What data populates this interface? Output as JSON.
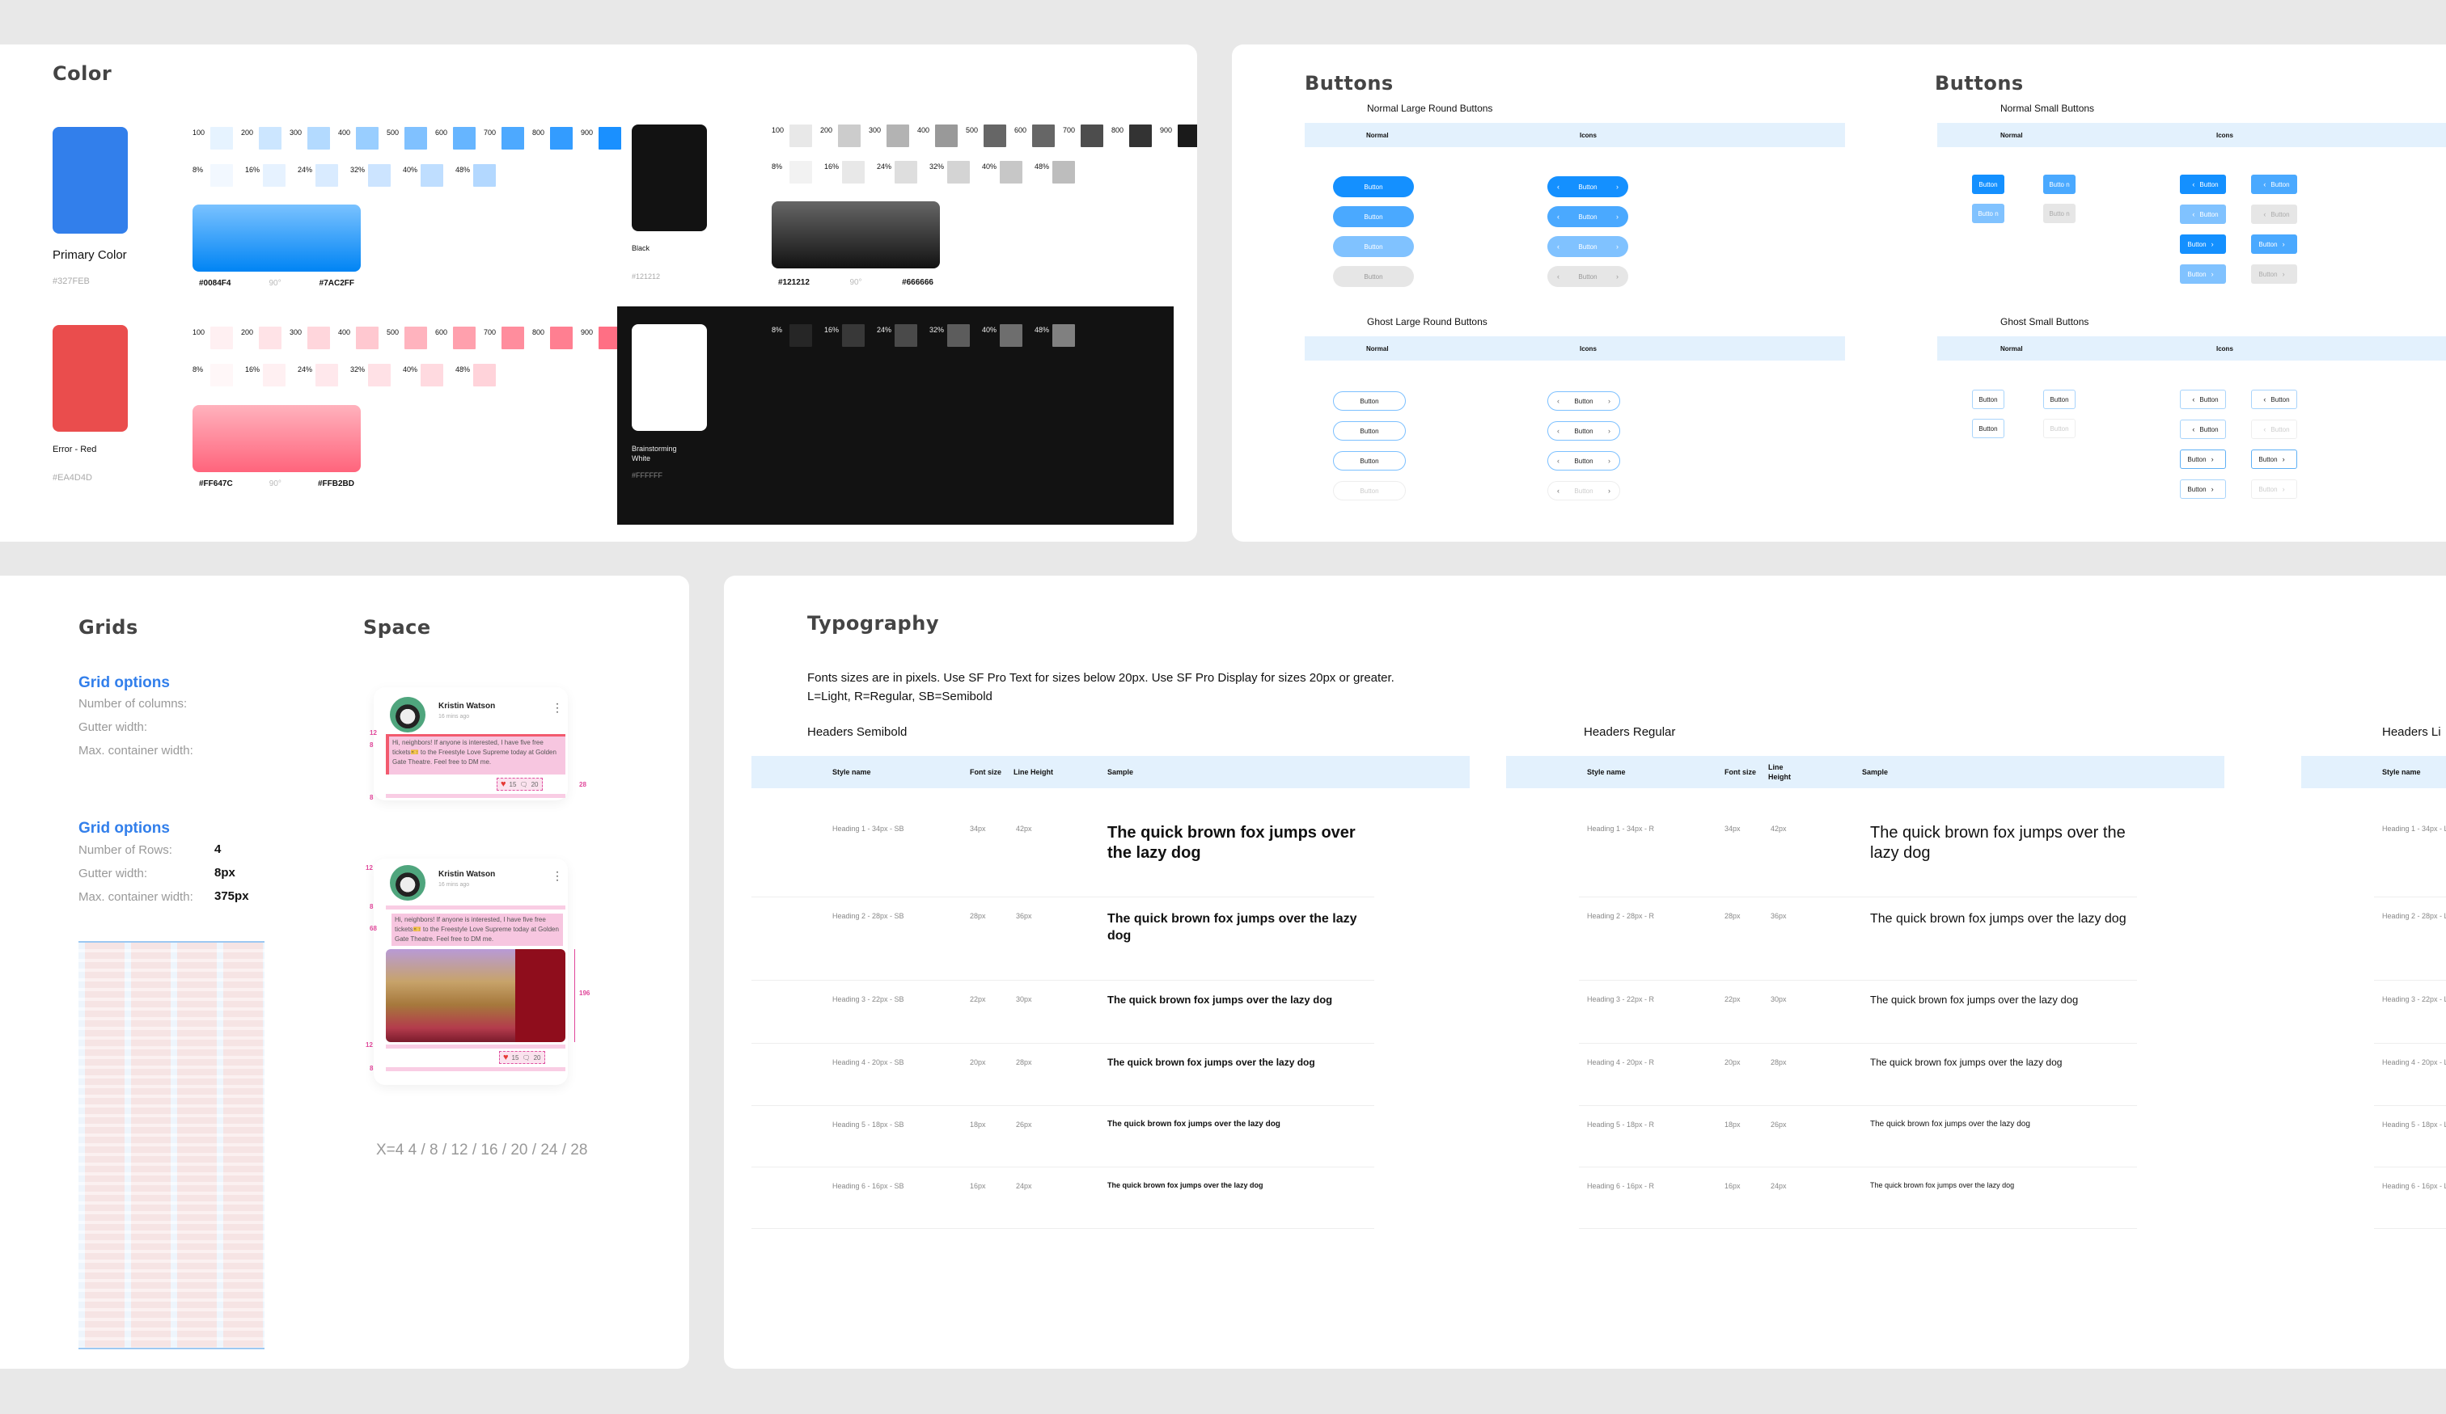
{
  "color": {
    "title": "Color",
    "shade_steps": [
      "100",
      "200",
      "300",
      "400",
      "500",
      "600",
      "700",
      "800",
      "900"
    ],
    "opacity_steps": [
      "8%",
      "16%",
      "24%",
      "32%",
      "40%",
      "48%"
    ],
    "gradient_angle": "90°",
    "primary": {
      "name": "Primary Color",
      "hex": "#327FEB",
      "swatch": "#327feb",
      "shades": [
        "#e6f3ff",
        "#cce6ff",
        "#b3daff",
        "#99ceff",
        "#80c1ff",
        "#66b5ff",
        "#4da9ff",
        "#339cff",
        "#1a90ff"
      ],
      "opacities": [
        "#f2f8ff",
        "#e6f2ff",
        "#d9ebff",
        "#cce4ff",
        "#bfdeff",
        "#b3d8ff"
      ],
      "gradient_from": "#0084F4",
      "gradient_to": "#7AC2FF"
    },
    "error": {
      "name": "Error - Red",
      "hex": "#EA4D4D",
      "swatch": "#ea4d4d",
      "shades": [
        "#fff0f2",
        "#ffe3e7",
        "#ffd6dc",
        "#ffc8d0",
        "#ffb3be",
        "#ffa0ad",
        "#ff8d9d",
        "#ff7f91",
        "#ff6f84"
      ],
      "opacities": [
        "#fff7f8",
        "#fff0f2",
        "#ffe8ec",
        "#ffe1e6",
        "#ffdae0",
        "#ffd3da"
      ],
      "gradient_from": "#FF647C",
      "gradient_to": "#FFB2BD"
    },
    "black": {
      "name": "Black",
      "hex": "#121212",
      "swatch": "#121212",
      "shades": [
        "#e8e8e8",
        "#cccccc",
        "#b3b3b3",
        "#999999",
        "#666666",
        "#666666",
        "#4d4d4d",
        "#333333",
        "#1a1a1a"
      ],
      "opacities": [
        "#f2f2f2",
        "#e8e8e8",
        "#dedede",
        "#d4d4d4",
        "#c7c7c7",
        "#bdbdbd"
      ],
      "gradient_from": "#121212",
      "gradient_to": "#666666"
    },
    "white": {
      "name_line1": "Brainstorming",
      "name_line2": "White",
      "hex": "#FFFFFF",
      "swatch": "#ffffff",
      "opacities": [
        "#262626",
        "#383838",
        "#4a4a4a",
        "#5c5c5c",
        "#6e6e6e",
        "#808080"
      ]
    }
  },
  "buttons": {
    "title_left": "Buttons",
    "title_right": "Buttons",
    "col_normal": "Normal",
    "col_icons": "Icons",
    "label": "Button",
    "label_wrapped": "Butto n",
    "normal_large_title": "Normal Large Round Buttons",
    "ghost_large_title": "Ghost Large Round Buttons",
    "normal_small_title": "Normal Small Buttons",
    "ghost_small_title": "Ghost Small Buttons",
    "state_colors": [
      "#1490ff",
      "#4aa9ff",
      "#80c2ff",
      "#e6e6e6"
    ],
    "chevron_left": "‹",
    "chevron_right": "›"
  },
  "grids": {
    "title": "Grids",
    "options_title_1": "Grid options",
    "options_1": [
      {
        "label": "Number of columns:",
        "value": ""
      },
      {
        "label": "Gutter width:",
        "value": ""
      },
      {
        "label": "Max. container width:",
        "value": ""
      }
    ],
    "options_title_2": "Grid options",
    "options_2": [
      {
        "label": "Number of Rows:",
        "value": "4"
      },
      {
        "label": "Gutter width:",
        "value": "8px"
      },
      {
        "label": "Max. container width:",
        "value": "375px"
      }
    ]
  },
  "space": {
    "title": "Space",
    "card": {
      "name": "Kristin Watson",
      "time": "16 mins ago",
      "text": "Hi, neighbors! If anyone is interested, I have five free tickets🎫 to the Freestyle Love Supreme today at Golden Gate Theatre. Feel free to DM me.",
      "likes": "15",
      "comments": "20"
    },
    "annotations": {
      "a12": "12",
      "a8": "8",
      "a28": "28",
      "a68": "68",
      "a196": "196"
    },
    "caption": "X=4 4 / 8 / 12 / 16 / 20 / 24 / 28"
  },
  "typography": {
    "title": "Typography",
    "desc_line1": "Fonts sizes are in pixels. Use SF Pro Text for sizes below 20px. Use SF Pro Display for sizes 20px or greater.",
    "desc_line2": "L=Light, R=Regular, SB=Semibold",
    "columns": {
      "style": "Style name",
      "size": "Font size",
      "line": "Line Height",
      "line_a": "Line",
      "line_b": "Height",
      "sample": "Sample"
    },
    "sample_text": "The quick brown fox jumps over the lazy dog",
    "tables": [
      {
        "title": "Headers Semibold",
        "rows": [
          {
            "style": "Heading 1 - 34px - SB",
            "size": "34px",
            "line": "42px"
          },
          {
            "style": "Heading 2 - 28px - SB",
            "size": "28px",
            "line": "36px"
          },
          {
            "style": "Heading 3 - 22px - SB",
            "size": "22px",
            "line": "30px"
          },
          {
            "style": "Heading 4 - 20px - SB",
            "size": "20px",
            "line": "28px"
          },
          {
            "style": "Heading 5 - 18px - SB",
            "size": "18px",
            "line": "26px"
          },
          {
            "style": "Heading 6 - 16px - SB",
            "size": "16px",
            "line": "24px"
          }
        ]
      },
      {
        "title": "Headers Regular",
        "rows": [
          {
            "style": "Heading 1 - 34px - R",
            "size": "34px",
            "line": "42px"
          },
          {
            "style": "Heading 2 - 28px - R",
            "size": "28px",
            "line": "36px"
          },
          {
            "style": "Heading 3 - 22px - R",
            "size": "22px",
            "line": "30px"
          },
          {
            "style": "Heading 4 - 20px - R",
            "size": "20px",
            "line": "28px"
          },
          {
            "style": "Heading 5 - 18px - R",
            "size": "18px",
            "line": "26px"
          },
          {
            "style": "Heading 6 - 16px - R",
            "size": "16px",
            "line": "24px"
          }
        ]
      },
      {
        "title": "Headers Li",
        "rows": [
          {
            "style": "Heading 1 - 34px - L"
          },
          {
            "style": "Heading 2 - 28px - L"
          },
          {
            "style": "Heading 3 - 22px - L"
          },
          {
            "style": "Heading 4 - 20px - L"
          },
          {
            "style": "Heading 5 - 18px - L"
          },
          {
            "style": "Heading 6 - 16px - L"
          }
        ]
      }
    ]
  }
}
